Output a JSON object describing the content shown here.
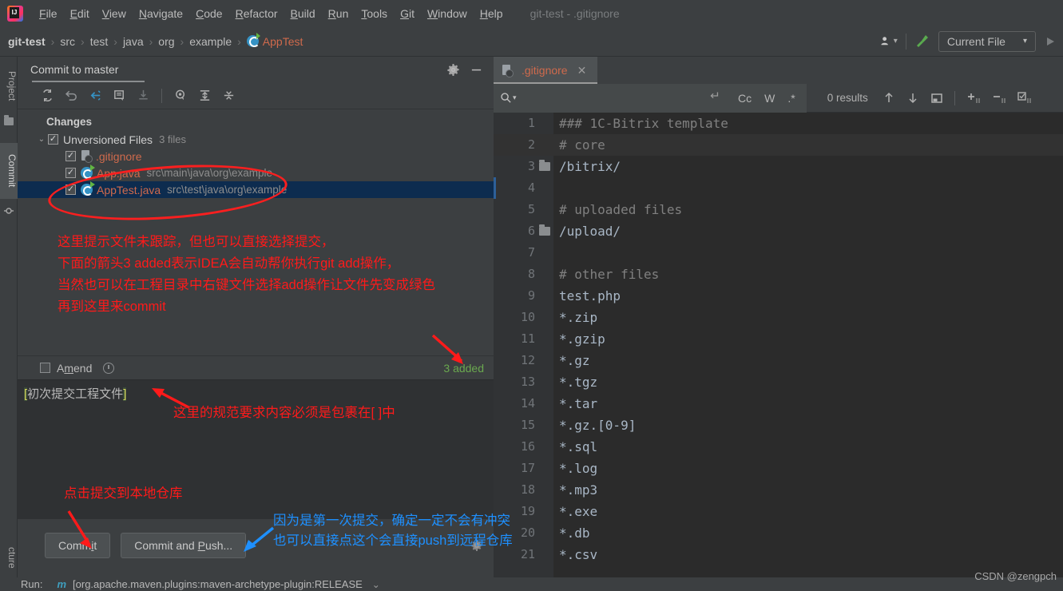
{
  "window": {
    "title": "git-test - .gitignore",
    "logo_icon": "intellij-idea-logo"
  },
  "menu": {
    "items": [
      {
        "label": "File",
        "mnemonic": "F"
      },
      {
        "label": "Edit",
        "mnemonic": "E"
      },
      {
        "label": "View",
        "mnemonic": "V"
      },
      {
        "label": "Navigate",
        "mnemonic": "N"
      },
      {
        "label": "Code",
        "mnemonic": "C"
      },
      {
        "label": "Refactor",
        "mnemonic": "R"
      },
      {
        "label": "Build",
        "mnemonic": "B"
      },
      {
        "label": "Run",
        "mnemonic": "R"
      },
      {
        "label": "Tools",
        "mnemonic": "T"
      },
      {
        "label": "Git",
        "mnemonic": "G"
      },
      {
        "label": "Window",
        "mnemonic": "W"
      },
      {
        "label": "Help",
        "mnemonic": "H"
      }
    ]
  },
  "navbar": {
    "crumbs": [
      "git-test",
      "src",
      "test",
      "java",
      "org",
      "example",
      "AppTest"
    ],
    "separator": "›",
    "file_icon": "java-class-icon",
    "account_icon": "user-account-icon",
    "account_caret": "▾",
    "build_icon": "hammer-build-icon",
    "run_config": "Current File",
    "run_config_caret": "▾",
    "run_icon": "▶"
  },
  "toolstrip": {
    "project_tab": "Project",
    "project_icon": "folder-icon",
    "commit_tab": "Commit",
    "commit_icon": "commit-node-icon",
    "structure_tab": "cture"
  },
  "commit_panel": {
    "title": "Commit to master",
    "settings_icon": "gear-icon",
    "minimize_icon": "minimize-icon",
    "toolbar_icons": [
      "refresh-icon",
      "rollback-icon",
      "shelve-silently-icon",
      "show-diff-icon",
      "get-from-vcs-icon",
      "preview-diff-icon",
      "expand-all-icon",
      "collapse-all-icon"
    ],
    "changes_label": "Changes",
    "group": {
      "chevron": "⌄",
      "label": "Unversioned Files",
      "count": "3 files",
      "checked": true
    },
    "files": [
      {
        "name": ".gitignore",
        "path": "",
        "icon": "gitignore-file-icon",
        "checked": true,
        "selected": false
      },
      {
        "name": "App.java",
        "path": "src\\main\\java\\org\\example",
        "icon": "java-class-icon",
        "checked": true,
        "selected": false
      },
      {
        "name": "AppTest.java",
        "path": "src\\test\\java\\org\\example",
        "icon": "java-class-icon",
        "checked": true,
        "selected": true
      }
    ],
    "amend_label_pre": "A",
    "amend_label_mn": "m",
    "amend_label_post": "end",
    "amend_checked": false,
    "history_icon": "clock-history-icon",
    "added_status": "3 added",
    "message_prefix": "[",
    "message_body": "初次提交工程文件",
    "message_suffix": "]",
    "commit_button_pre": "Comm",
    "commit_button_mn": "i",
    "commit_button_post": "t",
    "commit_push_button_pre": "Commit and ",
    "commit_push_button_mn": "P",
    "commit_push_button_post": "ush...",
    "bottom_gear_icon": "gear-icon"
  },
  "editor": {
    "tab_name": ".gitignore",
    "tab_icon": "gitignore-file-icon",
    "tab_close_icon": "close-icon",
    "find": {
      "search_icon": "search-icon",
      "search_caret": "▾",
      "value": "",
      "placeholder": "",
      "newline_icon": "multiline-icon",
      "match_case": "Cc",
      "words": "W",
      "regex": ".*",
      "results": "0 results",
      "prev_icon": "arrow-up-icon",
      "next_icon": "arrow-down-icon",
      "scope_icon": "select-in-scope-icon",
      "add_icon": "add-selection-icon",
      "remove_icon": "remove-selection-icon",
      "select_all_icon": "select-all-occurrences-icon"
    },
    "lines": [
      {
        "n": 1,
        "text": "### 1C-Bitrix template",
        "comment": true,
        "folder": false
      },
      {
        "n": 2,
        "text": "# core",
        "comment": true,
        "folder": false
      },
      {
        "n": 3,
        "text": "/bitrix/",
        "comment": false,
        "folder": true
      },
      {
        "n": 4,
        "text": "",
        "comment": false,
        "folder": false
      },
      {
        "n": 5,
        "text": "# uploaded files",
        "comment": true,
        "folder": false
      },
      {
        "n": 6,
        "text": "/upload/",
        "comment": false,
        "folder": true
      },
      {
        "n": 7,
        "text": "",
        "comment": false,
        "folder": false
      },
      {
        "n": 8,
        "text": "# other files",
        "comment": true,
        "folder": false
      },
      {
        "n": 9,
        "text": "test.php",
        "comment": false,
        "folder": false
      },
      {
        "n": 10,
        "text": "*.zip",
        "comment": false,
        "folder": false
      },
      {
        "n": 11,
        "text": "*.gzip",
        "comment": false,
        "folder": false
      },
      {
        "n": 12,
        "text": "*.gz",
        "comment": false,
        "folder": false
      },
      {
        "n": 13,
        "text": "*.tgz",
        "comment": false,
        "folder": false
      },
      {
        "n": 14,
        "text": "*.tar",
        "comment": false,
        "folder": false
      },
      {
        "n": 15,
        "text": "*.gz.[0-9]",
        "comment": false,
        "folder": false
      },
      {
        "n": 16,
        "text": "*.sql",
        "comment": false,
        "folder": false
      },
      {
        "n": 17,
        "text": "*.log",
        "comment": false,
        "folder": false
      },
      {
        "n": 18,
        "text": "*.mp3",
        "comment": false,
        "folder": false
      },
      {
        "n": 19,
        "text": "*.exe",
        "comment": false,
        "folder": false
      },
      {
        "n": 20,
        "text": "*.db",
        "comment": false,
        "folder": false
      },
      {
        "n": 21,
        "text": "*.csv",
        "comment": false,
        "folder": false
      }
    ]
  },
  "annotations": {
    "red_block": [
      "这里提示文件未跟踪，但也可以直接选择提交，",
      "下面的箭头3 added表示IDEA会自动帮你执行git add操作，",
      "当然也可以在工程目录中右键文件选择add操作让文件先变成绿色",
      "再到这里来commit"
    ],
    "message_note": "这里的规范要求内容必须是包裹在[ ]中",
    "commit_note": "点击提交到本地仓库",
    "push_note_line1": "因为是第一次提交，确定一定不会有冲突",
    "push_note_line2": "也可以直接点这个会直接push到远程仓库",
    "ellipse_icon": "red-ellipse-highlight",
    "arrow_icon": "red-arrow",
    "blue_arrow_icon": "blue-arrow",
    "colors": {
      "red": "#ff1a1a",
      "blue": "#1e90ff",
      "green": "#6aa84f",
      "file": "#cf6a4c"
    }
  },
  "statusbar": {
    "run_label": "Run:",
    "run_icon": "maven-icon",
    "run_text": "[org.apache.maven.plugins:maven-archetype-plugin:RELEASE",
    "collapse_icon": "⌄",
    "watermark": "CSDN @zengpch"
  }
}
